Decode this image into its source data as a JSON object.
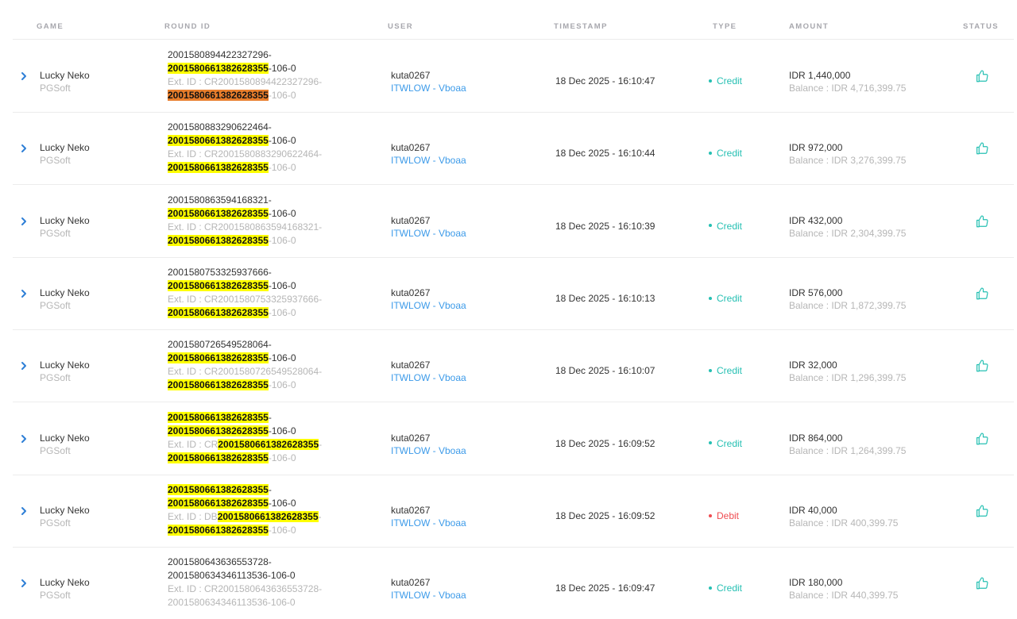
{
  "colors": {
    "credit": "#26c0b3",
    "debit": "#ef4c51",
    "link": "#3d9be9",
    "highlight": "#ffff00",
    "highlight_active": "#e87e2c",
    "muted": "#b6b6b6"
  },
  "header": {
    "game": "GAME",
    "round_id": "ROUND ID",
    "user": "USER",
    "timestamp": "TIMESTAMP",
    "type": "TYPE",
    "amount": "AMOUNT",
    "status": "STATUS"
  },
  "icons": {
    "expand": "chevron-right-icon",
    "status": "thumbs-up-icon"
  },
  "rows": [
    {
      "game": "Lucky Neko",
      "provider": "PGSoft",
      "round_lines": [
        {
          "cls": "main",
          "segs": [
            {
              "t": "2001580894422327296-"
            }
          ]
        },
        {
          "cls": "main",
          "segs": [
            {
              "t": "2001580661382628355",
              "hl": "y"
            },
            {
              "t": "-106-0"
            }
          ]
        },
        {
          "cls": "ext",
          "segs": [
            {
              "t": "Ext. ID : CR2001580894422327296-"
            }
          ]
        },
        {
          "cls": "ext",
          "segs": [
            {
              "t": "2001580661382628355",
              "hl": "o"
            },
            {
              "t": "-106-0"
            }
          ]
        }
      ],
      "user": "kuta0267",
      "agent": "ITWLOW - Vboaa",
      "timestamp": "18 Dec 2025 - 16:10:47",
      "type": "Credit",
      "type_class": "credit",
      "amount": "IDR 1,440,000",
      "balance": "Balance : IDR 4,716,399.75"
    },
    {
      "game": "Lucky Neko",
      "provider": "PGSoft",
      "round_lines": [
        {
          "cls": "main",
          "segs": [
            {
              "t": "2001580883290622464-"
            }
          ]
        },
        {
          "cls": "main",
          "segs": [
            {
              "t": "2001580661382628355",
              "hl": "y"
            },
            {
              "t": "-106-0"
            }
          ]
        },
        {
          "cls": "ext",
          "segs": [
            {
              "t": "Ext. ID : CR2001580883290622464-"
            }
          ]
        },
        {
          "cls": "ext",
          "segs": [
            {
              "t": "2001580661382628355",
              "hl": "y"
            },
            {
              "t": "-106-0"
            }
          ]
        }
      ],
      "user": "kuta0267",
      "agent": "ITWLOW - Vboaa",
      "timestamp": "18 Dec 2025 - 16:10:44",
      "type": "Credit",
      "type_class": "credit",
      "amount": "IDR 972,000",
      "balance": "Balance : IDR 3,276,399.75"
    },
    {
      "game": "Lucky Neko",
      "provider": "PGSoft",
      "round_lines": [
        {
          "cls": "main",
          "segs": [
            {
              "t": "2001580863594168321-"
            }
          ]
        },
        {
          "cls": "main",
          "segs": [
            {
              "t": "2001580661382628355",
              "hl": "y"
            },
            {
              "t": "-106-0"
            }
          ]
        },
        {
          "cls": "ext",
          "segs": [
            {
              "t": "Ext. ID : CR2001580863594168321-"
            }
          ]
        },
        {
          "cls": "ext",
          "segs": [
            {
              "t": "2001580661382628355",
              "hl": "y"
            },
            {
              "t": "-106-0"
            }
          ]
        }
      ],
      "user": "kuta0267",
      "agent": "ITWLOW - Vboaa",
      "timestamp": "18 Dec 2025 - 16:10:39",
      "type": "Credit",
      "type_class": "credit",
      "amount": "IDR 432,000",
      "balance": "Balance : IDR 2,304,399.75"
    },
    {
      "game": "Lucky Neko",
      "provider": "PGSoft",
      "round_lines": [
        {
          "cls": "main",
          "segs": [
            {
              "t": "2001580753325937666-"
            }
          ]
        },
        {
          "cls": "main",
          "segs": [
            {
              "t": "2001580661382628355",
              "hl": "y"
            },
            {
              "t": "-106-0"
            }
          ]
        },
        {
          "cls": "ext",
          "segs": [
            {
              "t": "Ext. ID : CR2001580753325937666-"
            }
          ]
        },
        {
          "cls": "ext",
          "segs": [
            {
              "t": "2001580661382628355",
              "hl": "y"
            },
            {
              "t": "-106-0"
            }
          ]
        }
      ],
      "user": "kuta0267",
      "agent": "ITWLOW - Vboaa",
      "timestamp": "18 Dec 2025 - 16:10:13",
      "type": "Credit",
      "type_class": "credit",
      "amount": "IDR 576,000",
      "balance": "Balance : IDR 1,872,399.75"
    },
    {
      "game": "Lucky Neko",
      "provider": "PGSoft",
      "round_lines": [
        {
          "cls": "main",
          "segs": [
            {
              "t": "2001580726549528064-"
            }
          ]
        },
        {
          "cls": "main",
          "segs": [
            {
              "t": "2001580661382628355",
              "hl": "y"
            },
            {
              "t": "-106-0"
            }
          ]
        },
        {
          "cls": "ext",
          "segs": [
            {
              "t": "Ext. ID : CR2001580726549528064-"
            }
          ]
        },
        {
          "cls": "ext",
          "segs": [
            {
              "t": "2001580661382628355",
              "hl": "y"
            },
            {
              "t": "-106-0"
            }
          ]
        }
      ],
      "user": "kuta0267",
      "agent": "ITWLOW - Vboaa",
      "timestamp": "18 Dec 2025 - 16:10:07",
      "type": "Credit",
      "type_class": "credit",
      "amount": "IDR 32,000",
      "balance": "Balance : IDR 1,296,399.75"
    },
    {
      "game": "Lucky Neko",
      "provider": "PGSoft",
      "round_lines": [
        {
          "cls": "main",
          "segs": [
            {
              "t": "2001580661382628355",
              "hl": "y"
            },
            {
              "t": "-"
            }
          ]
        },
        {
          "cls": "main",
          "segs": [
            {
              "t": "2001580661382628355",
              "hl": "y"
            },
            {
              "t": "-106-0"
            }
          ]
        },
        {
          "cls": "ext",
          "segs": [
            {
              "t": "Ext. ID : CR"
            },
            {
              "t": "2001580661382628355",
              "hl": "y"
            },
            {
              "t": "-"
            }
          ]
        },
        {
          "cls": "ext",
          "segs": [
            {
              "t": "2001580661382628355",
              "hl": "y"
            },
            {
              "t": "-106-0"
            }
          ]
        }
      ],
      "user": "kuta0267",
      "agent": "ITWLOW - Vboaa",
      "timestamp": "18 Dec 2025 - 16:09:52",
      "type": "Credit",
      "type_class": "credit",
      "amount": "IDR 864,000",
      "balance": "Balance : IDR 1,264,399.75"
    },
    {
      "game": "Lucky Neko",
      "provider": "PGSoft",
      "round_lines": [
        {
          "cls": "main",
          "segs": [
            {
              "t": "2001580661382628355",
              "hl": "y"
            },
            {
              "t": "-"
            }
          ]
        },
        {
          "cls": "main",
          "segs": [
            {
              "t": "2001580661382628355",
              "hl": "y"
            },
            {
              "t": "-106-0"
            }
          ]
        },
        {
          "cls": "ext",
          "segs": [
            {
              "t": "Ext. ID : DB"
            },
            {
              "t": "2001580661382628355",
              "hl": "y"
            },
            {
              "t": "-"
            }
          ]
        },
        {
          "cls": "ext",
          "segs": [
            {
              "t": "2001580661382628355",
              "hl": "y"
            },
            {
              "t": "-106-0"
            }
          ]
        }
      ],
      "user": "kuta0267",
      "agent": "ITWLOW - Vboaa",
      "timestamp": "18 Dec 2025 - 16:09:52",
      "type": "Debit",
      "type_class": "debit",
      "amount": "IDR 40,000",
      "balance": "Balance : IDR 400,399.75"
    },
    {
      "game": "Lucky Neko",
      "provider": "PGSoft",
      "round_lines": [
        {
          "cls": "main",
          "segs": [
            {
              "t": "2001580643636553728-"
            }
          ]
        },
        {
          "cls": "main",
          "segs": [
            {
              "t": "2001580634346113536-106-0"
            }
          ]
        },
        {
          "cls": "ext",
          "segs": [
            {
              "t": "Ext. ID : CR2001580643636553728-"
            }
          ]
        },
        {
          "cls": "ext",
          "segs": [
            {
              "t": "2001580634346113536-106-0"
            }
          ]
        }
      ],
      "user": "kuta0267",
      "agent": "ITWLOW - Vboaa",
      "timestamp": "18 Dec 2025 - 16:09:47",
      "type": "Credit",
      "type_class": "credit",
      "amount": "IDR 180,000",
      "balance": "Balance : IDR 440,399.75"
    }
  ]
}
